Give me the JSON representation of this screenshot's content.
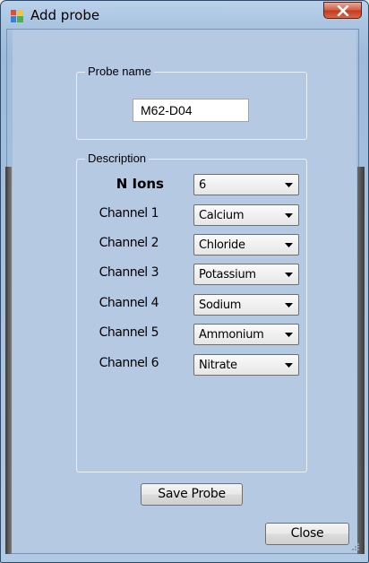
{
  "window": {
    "title": "Add probe"
  },
  "probe_group": {
    "legend": "Probe name",
    "name_value": "M62-D04"
  },
  "description_group": {
    "legend": "Description",
    "n_ions_label": "N Ions",
    "n_ions_value": "6",
    "channels": [
      {
        "label": "Channel 1",
        "value": "Calcium"
      },
      {
        "label": "Channel 2",
        "value": "Chloride"
      },
      {
        "label": "Channel 3",
        "value": "Potassium"
      },
      {
        "label": "Channel 4",
        "value": "Sodium"
      },
      {
        "label": "Channel 5",
        "value": "Ammonium"
      },
      {
        "label": "Channel 6",
        "value": "Nitrate"
      }
    ]
  },
  "buttons": {
    "save": "Save Probe",
    "close": "Close"
  },
  "icons": {
    "app": "app-window-icon",
    "close": "close-icon",
    "dropdown": "chevron-down-icon",
    "grip": "resize-grip-icon"
  },
  "colors": {
    "client_background": "#b5c9e3",
    "close_button": "#c9482c"
  }
}
